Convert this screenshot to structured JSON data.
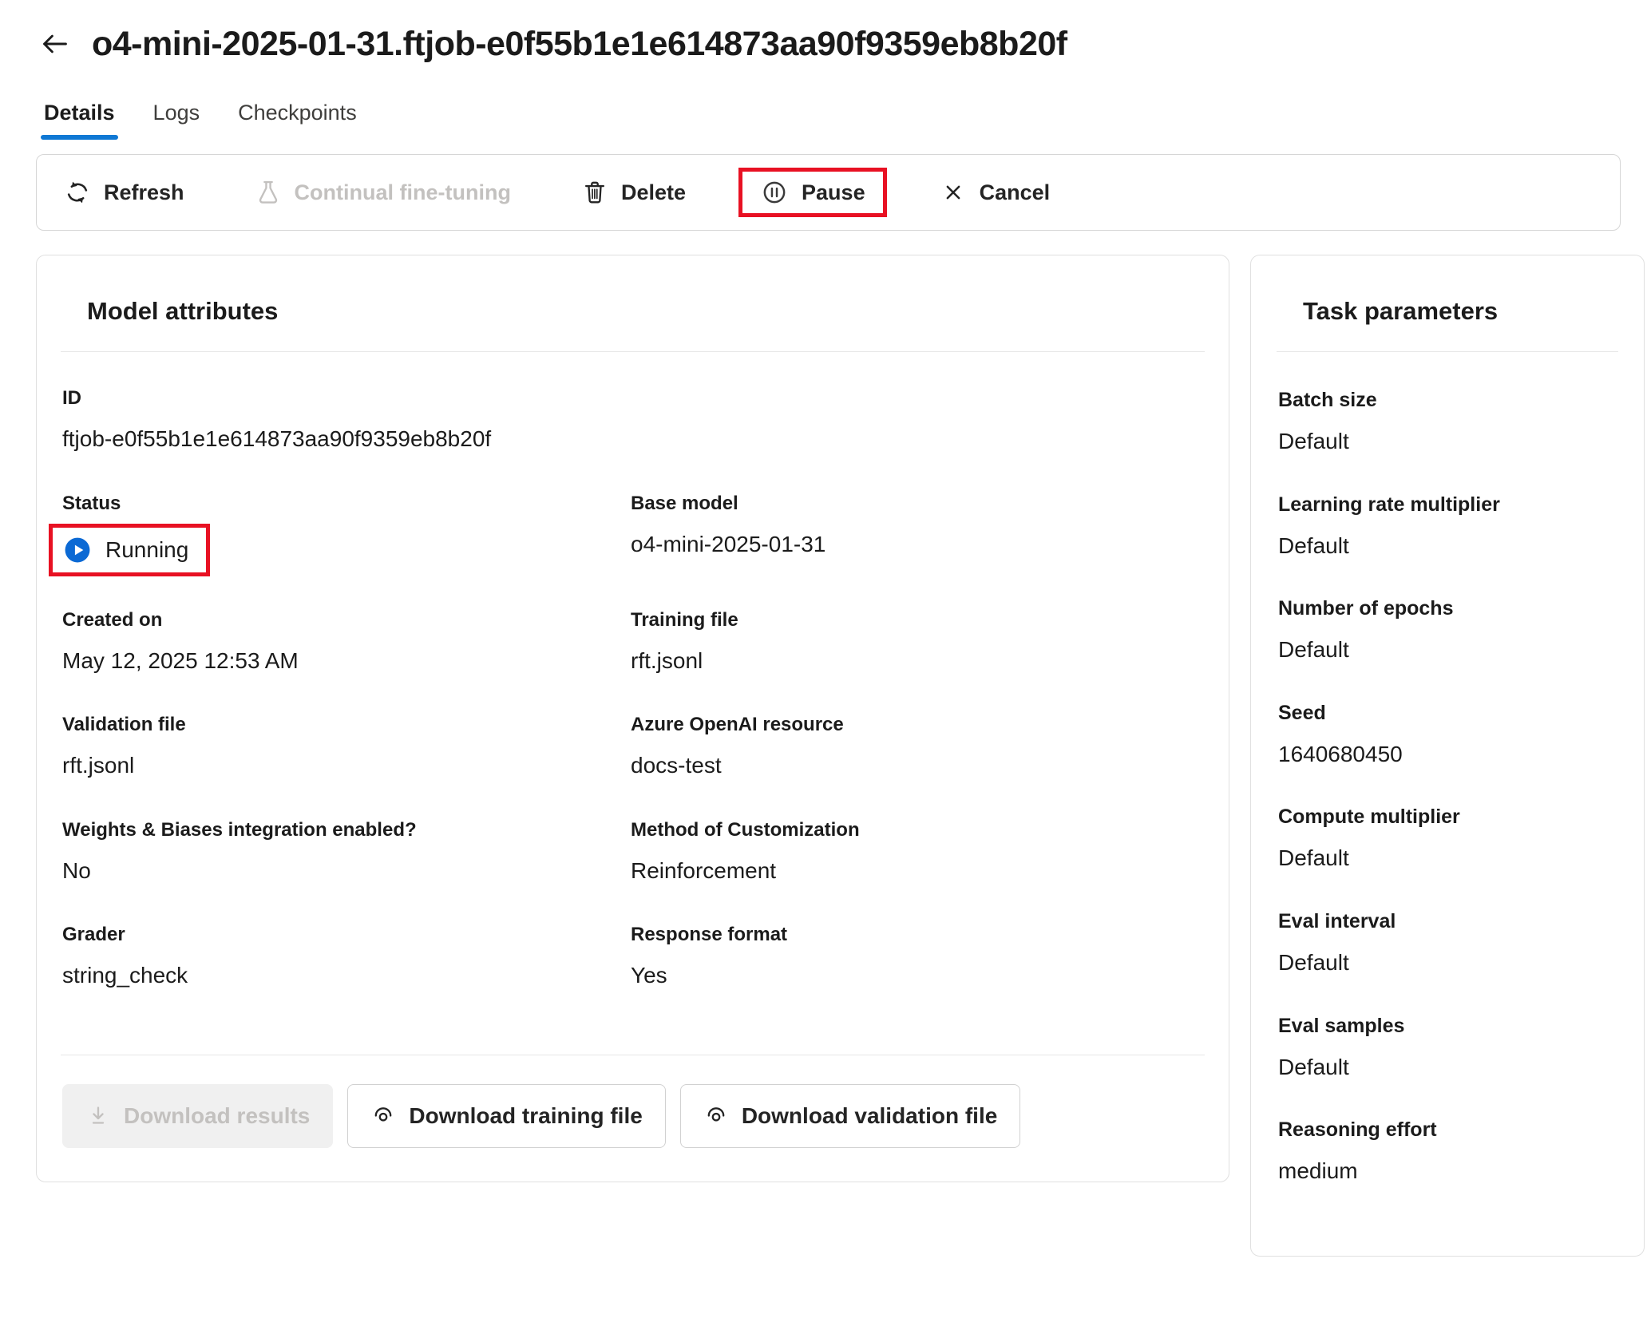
{
  "header": {
    "title": "o4-mini-2025-01-31.ftjob-e0f55b1e1e614873aa90f9359eb8b20f"
  },
  "tabs": [
    {
      "label": "Details",
      "active": true
    },
    {
      "label": "Logs",
      "active": false
    },
    {
      "label": "Checkpoints",
      "active": false
    }
  ],
  "toolbar": {
    "refresh": "Refresh",
    "continual_fine_tuning": "Continual fine-tuning",
    "delete": "Delete",
    "pause": "Pause",
    "cancel": "Cancel"
  },
  "model_attributes": {
    "title": "Model attributes",
    "fields": {
      "id": {
        "label": "ID",
        "value": "ftjob-e0f55b1e1e614873aa90f9359eb8b20f"
      },
      "status": {
        "label": "Status",
        "value": "Running"
      },
      "base_model": {
        "label": "Base model",
        "value": "o4-mini-2025-01-31"
      },
      "created_on": {
        "label": "Created on",
        "value": "May 12, 2025 12:53 AM"
      },
      "training_file": {
        "label": "Training file",
        "value": "rft.jsonl"
      },
      "validation_file": {
        "label": "Validation file",
        "value": "rft.jsonl"
      },
      "resource": {
        "label": "Azure OpenAI resource",
        "value": "docs-test"
      },
      "wandb": {
        "label": "Weights & Biases integration enabled?",
        "value": "No"
      },
      "method": {
        "label": "Method of Customization",
        "value": "Reinforcement"
      },
      "grader": {
        "label": "Grader",
        "value": "string_check"
      },
      "response_format": {
        "label": "Response format",
        "value": "Yes"
      }
    },
    "buttons": {
      "download_results": "Download results",
      "download_training": "Download training file",
      "download_validation": "Download validation file"
    }
  },
  "task_parameters": {
    "title": "Task parameters",
    "fields": [
      {
        "label": "Batch size",
        "value": "Default"
      },
      {
        "label": "Learning rate multiplier",
        "value": "Default"
      },
      {
        "label": "Number of epochs",
        "value": "Default"
      },
      {
        "label": "Seed",
        "value": "1640680450"
      },
      {
        "label": "Compute multiplier",
        "value": "Default"
      },
      {
        "label": "Eval interval",
        "value": "Default"
      },
      {
        "label": "Eval samples",
        "value": "Default"
      },
      {
        "label": "Reasoning effort",
        "value": "medium"
      }
    ]
  },
  "icons": {
    "back": "back-arrow-icon",
    "refresh": "refresh-sync-icon",
    "continual_fine_tuning": "flask-icon",
    "delete": "trash-icon",
    "pause": "pause-circle-icon",
    "cancel": "x-dismiss-icon",
    "status_running": "play-circle-icon",
    "download": "download-arrow-icon",
    "preview": "preview-eye-icon"
  },
  "colors": {
    "accent": "#0f78d4",
    "status_blue": "#0b69d4",
    "highlight_red": "#e81123",
    "disabled_text": "#c3c1bf"
  }
}
